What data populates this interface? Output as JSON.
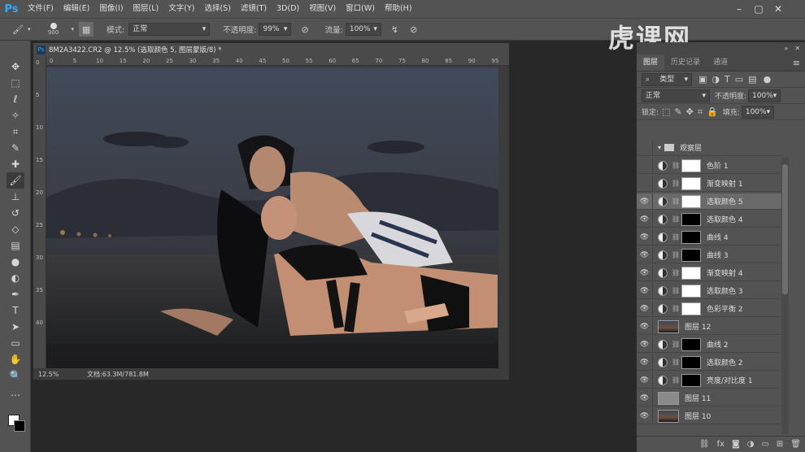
{
  "app": {
    "logo": "Ps"
  },
  "menu": [
    "文件(F)",
    "编辑(E)",
    "图像(I)",
    "图层(L)",
    "文字(Y)",
    "选择(S)",
    "滤镜(T)",
    "3D(D)",
    "视图(V)",
    "窗口(W)",
    "帮助(H)"
  ],
  "options": {
    "brush_size": "900",
    "mode_label": "模式:",
    "mode_value": "正常",
    "opacity_label": "不透明度:",
    "opacity_value": "99%",
    "flow_label": "流量:",
    "flow_value": "100%"
  },
  "document": {
    "tab_title": "8M2A3422.CR2 @ 12.5% (选取颜色 5, 图层蒙版/8) *",
    "zoom": "12.5%",
    "doc_info": "文档:63.3M/781.8M",
    "ruler_h": [
      "0",
      "5",
      "10",
      "15",
      "20",
      "25",
      "30",
      "35",
      "40",
      "45",
      "50",
      "55",
      "60",
      "65",
      "70",
      "75",
      "80",
      "85",
      "90",
      "95"
    ]
  },
  "layers_panel": {
    "tabs": [
      "图层",
      "历史记录",
      "通道"
    ],
    "filter_value": "类型",
    "blend_mode": "正常",
    "opacity_label": "不透明度:",
    "opacity_value": "100%",
    "lock_label": "锁定:",
    "fill_label": "填充:",
    "fill_value": "100%",
    "group_name": "观察层",
    "layers": [
      {
        "name": "色阶 1",
        "visible": false,
        "kind": "adj",
        "mask": "#ffffff"
      },
      {
        "name": "渐变映射 1",
        "visible": false,
        "kind": "adj",
        "mask": "#ffffff"
      },
      {
        "name": "选取颜色 5",
        "visible": true,
        "kind": "adj",
        "mask": "#ffffff",
        "selected": true
      },
      {
        "name": "选取颜色 4",
        "visible": true,
        "kind": "adj",
        "mask": "#000000"
      },
      {
        "name": "曲线 4",
        "visible": true,
        "kind": "adj",
        "mask": "#000000"
      },
      {
        "name": "曲线 3",
        "visible": true,
        "kind": "adj",
        "mask": "#000000"
      },
      {
        "name": "渐变映射 4",
        "visible": true,
        "kind": "adj",
        "mask": "#ffffff"
      },
      {
        "name": "选取颜色 3",
        "visible": true,
        "kind": "adj",
        "mask": "#ffffff"
      },
      {
        "name": "色彩平衡 2",
        "visible": true,
        "kind": "adj",
        "mask": "#ffffff"
      },
      {
        "name": "图层 12",
        "visible": true,
        "kind": "photo"
      },
      {
        "name": "曲线 2",
        "visible": true,
        "kind": "adj",
        "mask": "#000000"
      },
      {
        "name": "选取颜色 2",
        "visible": true,
        "kind": "adj",
        "mask": "#000000"
      },
      {
        "name": "亮度/对比度 1",
        "visible": true,
        "kind": "adj",
        "mask": "#000000"
      },
      {
        "name": "图层 11",
        "visible": true,
        "kind": "gray"
      },
      {
        "name": "图层 10",
        "visible": true,
        "kind": "photo"
      }
    ]
  },
  "watermark": "虎课网"
}
